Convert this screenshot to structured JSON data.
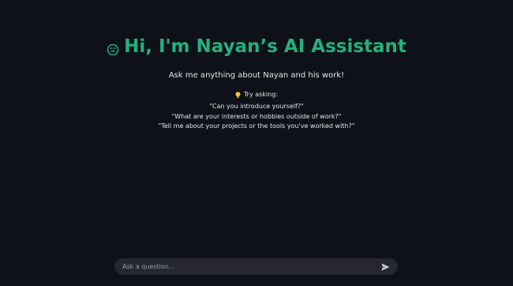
{
  "header": {
    "title_icon": "smiling-face-icon",
    "title": "Hi, I'm Nayan’s AI Assistant",
    "subtitle": "Ask me anything about Nayan and his work!"
  },
  "suggestions": {
    "icon": "lightbulb-icon",
    "heading": "Try asking:",
    "items": [
      "\"Can you introduce yourself?\"",
      "\"What are your interests or hobbies outside of work?\"",
      "\"Tell me about your projects or the tools you've worked with?\""
    ]
  },
  "chat": {
    "placeholder": "Ask a question...",
    "send_icon": "send-icon"
  },
  "colors": {
    "background": "#0e1117",
    "accent": "#23b07d",
    "input_bg": "#262730",
    "text": "#e6e6e6"
  }
}
